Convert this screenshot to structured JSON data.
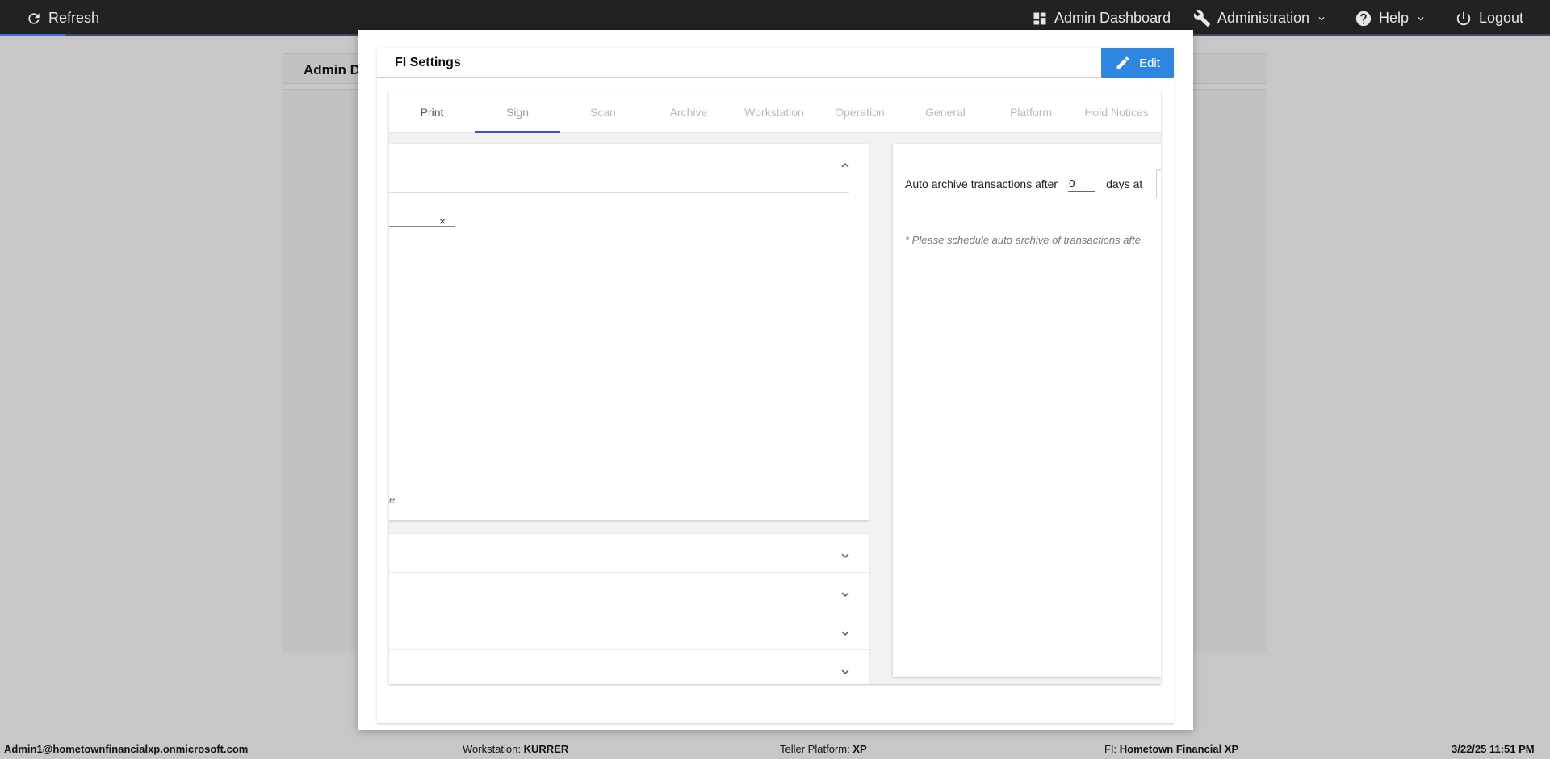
{
  "topnav": {
    "refresh": "Refresh",
    "admin_dashboard": "Admin Dashboard",
    "administration": "Administration",
    "help": "Help",
    "logout": "Logout"
  },
  "background": {
    "header_title": "Admin D"
  },
  "modal": {
    "title": "FI Settings",
    "edit_label": "Edit",
    "tabs": [
      "Print",
      "Sign",
      "Scan",
      "Archive",
      "Workstation",
      "Operation",
      "General",
      "Platform",
      "Hold Notices"
    ],
    "active_tab": "Sign",
    "left_card": {
      "clear_icon": "×",
      "note_fragment": "e."
    },
    "right_card": {
      "auto_archive_prefix": "Auto archive transactions after",
      "days_value": "0",
      "auto_archive_suffix": "days at",
      "schedule_note": "* Please schedule auto archive of transactions afte"
    }
  },
  "statusbar": {
    "user": "Admin1@hometownfinancialxp.onmicrosoft.com",
    "workstation_label": "Workstation:",
    "workstation_value": "KURRER",
    "platform_label": "Teller Platform:",
    "platform_value": "XP",
    "fi_label": "FI:",
    "fi_value": "Hometown Financial XP",
    "datetime": "3/22/25 11:51 PM"
  },
  "colors": {
    "nav_bg": "#222222",
    "edit_button": "#2f86e0",
    "active_tab_indicator": "#3a52c4"
  }
}
